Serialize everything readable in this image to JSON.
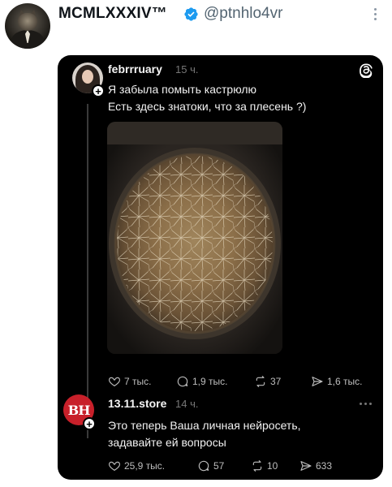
{
  "tweet": {
    "display_name": "MCMLXXXIV™",
    "handle": "@ptnhlo4vr",
    "icons": {
      "verified": "verified-badge-icon",
      "more": "more-vertical-icon"
    },
    "colors": {
      "verified": "#1d9bf0",
      "name": "#0f1419",
      "handle": "#536471"
    }
  },
  "card": {
    "background": "#000000",
    "app_icon": "threads-logo-icon",
    "post": {
      "username": "febrrruary",
      "time": "15 ч.",
      "lines": [
        "Я забыла помыть кастрюлю",
        "Есть здесь знатоки, что за плесень ?)"
      ],
      "image": "photo of a pot with moldy residue",
      "actions": [
        {
          "icon": "heart-icon",
          "label": "7 тыс."
        },
        {
          "icon": "comment-icon",
          "label": "1,9 тыс."
        },
        {
          "icon": "repost-icon",
          "label": "37"
        },
        {
          "icon": "share-icon",
          "label": "1,6 тыс."
        }
      ]
    },
    "reply": {
      "avatar_text": "ВН",
      "avatar_color": "#c8202a",
      "username": "13.11.store",
      "time": "14 ч.",
      "lines": [
        "Это теперь Ваша личная нейросеть,",
        "задавайте ей вопросы"
      ],
      "actions": [
        {
          "icon": "heart-icon",
          "label": "25,9 тыс."
        },
        {
          "icon": "comment-icon",
          "label": "57"
        },
        {
          "icon": "repost-icon",
          "label": "10"
        },
        {
          "icon": "share-icon",
          "label": "633"
        }
      ]
    }
  }
}
